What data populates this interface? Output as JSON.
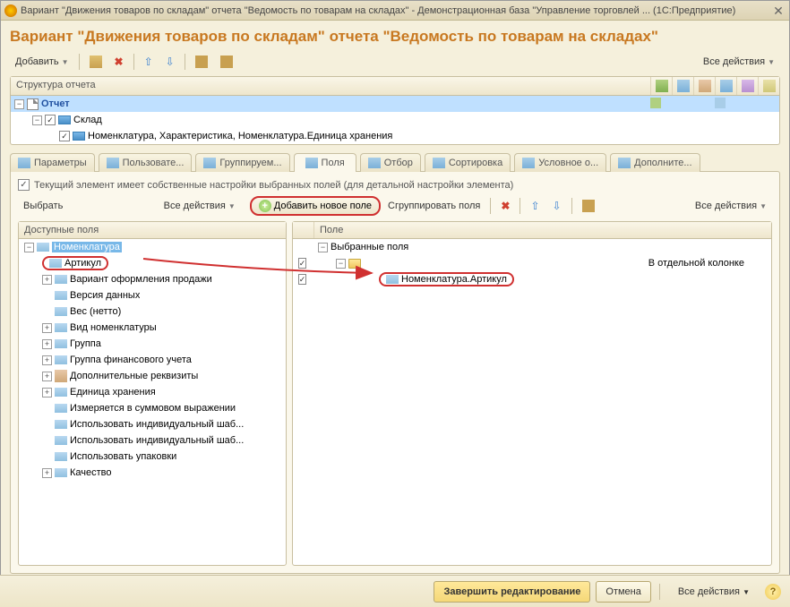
{
  "window": {
    "title": "Вариант \"Движения товаров по складам\" отчета \"Ведомость по товарам на складах\" - Демонстрационная база \"Управление торговлей ...   (1С:Предприятие)"
  },
  "heading": "Вариант \"Движения товаров по складам\" отчета \"Ведомость по товарам на складах\"",
  "toolbar": {
    "add": "Добавить",
    "all_actions": "Все действия"
  },
  "structure": {
    "header": "Структура отчета",
    "rows": [
      {
        "label": "Отчет"
      },
      {
        "label": "Склад"
      },
      {
        "label": "Номенклатура, Характеристика, Номенклатура.Единица хранения"
      }
    ]
  },
  "tabs": {
    "t0": "Параметры",
    "t1": "Пользовате...",
    "t2": "Группируем...",
    "t3": "Поля",
    "t4": "Отбор",
    "t5": "Сортировка",
    "t6": "Условное о...",
    "t7": "Дополните..."
  },
  "info": "Текущий элемент имеет собственные настройки выбранных полей (для детальной настройки элемента)",
  "subtoolbar": {
    "select": "Выбрать",
    "all_actions_l": "Все действия",
    "add_field": "Добавить новое поле",
    "group_fields": "Сгруппировать поля",
    "all_actions_r": "Все действия"
  },
  "avail": {
    "header": "Доступные поля",
    "root": "Номенклатура",
    "items": [
      "Артикул",
      "Вариант оформления продажи",
      "Версия данных",
      "Вес (нетто)",
      "Вид номенклатуры",
      "Группа",
      "Группа финансового учета",
      "Дополнительные реквизиты",
      "Единица хранения",
      "Измеряется в суммовом выражении",
      "Использовать индивидуальный шаб...",
      "Использовать индивидуальный шаб...",
      "Использовать упаковки",
      "Качество"
    ]
  },
  "selected": {
    "header": "Поле",
    "root": "Выбранные поля",
    "group_col": "В отдельной колонке",
    "item": "Номенклатура.Артикул"
  },
  "footer": {
    "finish": "Завершить редактирование",
    "cancel": "Отмена",
    "all_actions": "Все действия"
  }
}
